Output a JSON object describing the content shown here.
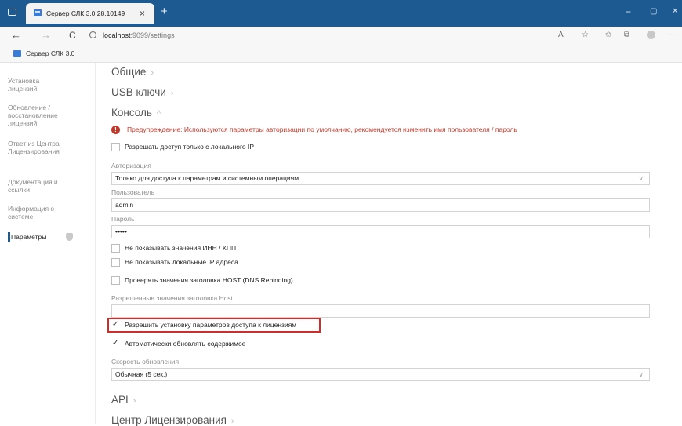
{
  "browser": {
    "tab_title": "Сервер СЛК 3.0.28.10149",
    "tab_close": "×",
    "new_tab": "+",
    "url_host": "localhost",
    "url_rest": ":9099/settings",
    "favorite_label": "Сервер СЛК 3.0",
    "back": "←",
    "forward": "→",
    "reload": "C",
    "info": "i",
    "window_min": "−",
    "window_max": "▢",
    "window_close": "✕",
    "tool_read_aloud": "Aʹ",
    "tool_favorite": "☆",
    "tool_favorites": "✩",
    "tool_collections": "⧉",
    "tool_more": "···"
  },
  "sidebar": {
    "items": [
      {
        "label_lines": [
          "Установка",
          "лицензий"
        ]
      },
      {
        "label_lines": [
          "Обновление /",
          "восстановление",
          "лицензий"
        ]
      },
      {
        "label_lines": [
          "Ответ из Центра",
          "Лицензирования"
        ]
      },
      {
        "label_lines": [
          "Документация и",
          "ссылки"
        ]
      },
      {
        "label_lines": [
          "Информация о",
          "системе"
        ]
      },
      {
        "label_lines": [
          "Параметры"
        ]
      }
    ]
  },
  "sections": {
    "general": "Общие",
    "usb": "USB ключи",
    "console": "Консоль",
    "api": "API",
    "license_center": "Центр Лицензирования"
  },
  "warning": {
    "icon": "!",
    "text": "Предупреждение: Используются параметры авторизации по умолчанию, рекомендуется изменить имя пользователя / пароль"
  },
  "console": {
    "local_ip_only": {
      "label": "Разрешать доступ только с локального IP",
      "checked": false
    },
    "auth_label": "Авторизация",
    "auth_value": "Только для доступа к параметрам и системным операциям",
    "user_label": "Пользователь",
    "user_value": "admin",
    "password_label": "Пароль",
    "password_value": "•••••",
    "hide_inn": {
      "label": "Не показывать значения ИНН / КПП",
      "checked": false
    },
    "hide_ip": {
      "label": "Не показывать локальные IP адреса",
      "checked": false
    },
    "check_host": {
      "label": "Проверять значения заголовка HOST (DNS Rebinding)",
      "checked": false
    },
    "host_values_label": "Разрешенные значения заголовка Host",
    "host_values_value": "",
    "allow_license_access": {
      "label": "Разрешить установку параметров доступа к лицензиям",
      "checked": true
    },
    "auto_refresh": {
      "label": "Автоматически обновлять содержимое",
      "checked": true
    },
    "refresh_speed_label": "Скорость обновления",
    "refresh_speed_value": "Обычная (5 сек.)"
  },
  "icons": {
    "chevron_right": "›",
    "chevron_up": "^",
    "dropdown": "∨"
  },
  "colors": {
    "titlebar": "#1d5a92",
    "warning": "#c0392b",
    "highlight": "#d32a2a"
  }
}
